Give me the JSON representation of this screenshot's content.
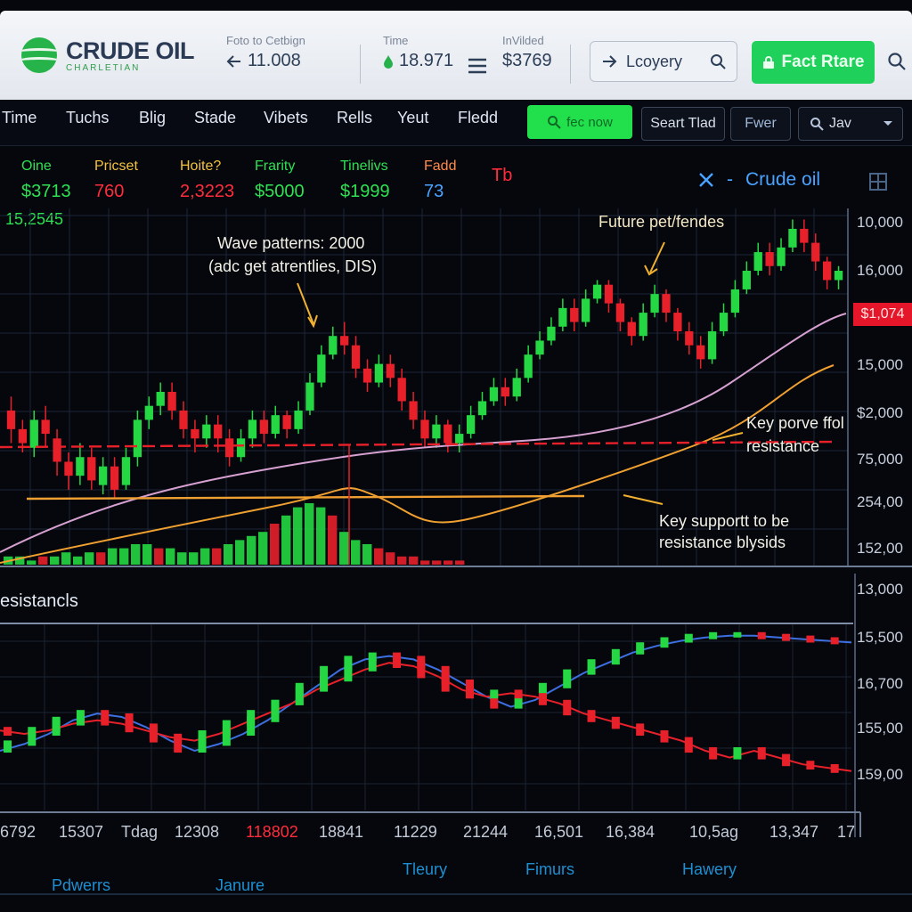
{
  "header": {
    "logo_title": "CRUDE OIL",
    "logo_sub": "CHARLETIAN",
    "stats": [
      {
        "label": "Foto to Cetbign",
        "value": "11.008",
        "icon": "arrow-left-icon"
      },
      {
        "label": "Time",
        "value": "18.971",
        "icon": "drop-icon"
      },
      {
        "label": "InVilded",
        "value": "$3769",
        "icon": "menu-icon"
      }
    ],
    "search_label": "Lcoyery",
    "green_button": "Fact Rtare"
  },
  "nav": {
    "items": [
      "Time",
      "Tuchs",
      "Blig",
      "Stade",
      "Vibets",
      "Rells",
      "Yeut",
      "Fledd"
    ],
    "green_button": "fec now",
    "button_2": "Seart Tlad",
    "button_3": "Fwer",
    "button_4": "Jav"
  },
  "ticker": [
    {
      "label": "Oine",
      "value": "$3713",
      "label_color": "#2ee052",
      "value_color": "#2ee052"
    },
    {
      "label": "Pricset",
      "value": "760",
      "label_color": "#f2c240",
      "value_color": "#ff2d3c"
    },
    {
      "label": "Hoite?",
      "value": "2,3223",
      "label_color": "#f2c240",
      "value_color": "#ff2d3c"
    },
    {
      "label": "Frarity",
      "value": "$5000",
      "label_color": "#2ee052",
      "value_color": "#2ee052"
    },
    {
      "label": "Tinelivs",
      "value": "$1999",
      "label_color": "#2ee052",
      "value_color": "#2ee052"
    },
    {
      "label": "Fadd",
      "value": "73",
      "label_color": "#ff8a4a",
      "value_color": "#4aa3ff"
    },
    {
      "label": "",
      "value": "Tb",
      "label_color": "#ff2d3c",
      "value_color": "#ff2d3c"
    }
  ],
  "ticker_extra": "15,2545",
  "chart_title": "Crude oil",
  "annotations": {
    "wave": "Wave patterns: 2000",
    "wave_sub": "(adc get atrentlies, DIS)",
    "future": "Future pet/fendes",
    "key_resistance_1": "Key porve ffol",
    "key_resistance_2": "resistance",
    "key_support_1": "Key supportt to be",
    "key_support_2": "resistance blysids"
  },
  "price_tag": "$1,074",
  "y_axis_upper": [
    "10,000",
    "16,000",
    "15,000",
    "$2,000",
    "75,000",
    "254,00",
    "152,00"
  ],
  "y_axis_lower": [
    "13,000",
    "15,500",
    "16,700",
    "155,00",
    "159,00"
  ],
  "lower_title": "esistancls",
  "x_axis": [
    "6792",
    "15307",
    "Tdag",
    "12308",
    "118802",
    "18841",
    "11229",
    "21244",
    "16,501",
    "16,384",
    "10,5ag",
    "13,347",
    "17"
  ],
  "footer": [
    "Pdwerrs",
    "Janure",
    "Tleury",
    "Fimurs",
    "Hawery"
  ],
  "colors": {
    "up": "#25d843",
    "down": "#e8202a",
    "accent_blue": "#4aa3ff",
    "support": "#f0a030",
    "resistance": "#e8202a"
  },
  "chart_data": [
    {
      "type": "candlestick",
      "title": "Crude oil",
      "ylabel_ticks": [
        "10,000",
        "16,000",
        "15,000",
        "$2,000",
        "75,000",
        "254,00",
        "152,00"
      ],
      "series": [
        {
          "kind": "candles",
          "values": [
            [
              0.72,
              0.68,
              0.75,
              0.65
            ],
            [
              0.68,
              0.65,
              0.7,
              0.63
            ],
            [
              0.64,
              0.7,
              0.72,
              0.62
            ],
            [
              0.7,
              0.67,
              0.73,
              0.64
            ],
            [
              0.66,
              0.61,
              0.68,
              0.58
            ],
            [
              0.61,
              0.58,
              0.63,
              0.55
            ],
            [
              0.58,
              0.62,
              0.65,
              0.56
            ],
            [
              0.62,
              0.57,
              0.64,
              0.55
            ],
            [
              0.56,
              0.6,
              0.62,
              0.54
            ],
            [
              0.6,
              0.55,
              0.62,
              0.53
            ],
            [
              0.56,
              0.62,
              0.64,
              0.55
            ],
            [
              0.62,
              0.7,
              0.72,
              0.6
            ],
            [
              0.7,
              0.73,
              0.75,
              0.68
            ],
            [
              0.73,
              0.76,
              0.78,
              0.71
            ],
            [
              0.76,
              0.72,
              0.78,
              0.7
            ],
            [
              0.72,
              0.68,
              0.74,
              0.66
            ],
            [
              0.68,
              0.66,
              0.7,
              0.63
            ],
            [
              0.66,
              0.69,
              0.71,
              0.64
            ],
            [
              0.69,
              0.66,
              0.71,
              0.63
            ],
            [
              0.66,
              0.62,
              0.68,
              0.6
            ],
            [
              0.62,
              0.66,
              0.68,
              0.61
            ],
            [
              0.66,
              0.7,
              0.72,
              0.64
            ],
            [
              0.7,
              0.67,
              0.72,
              0.65
            ],
            [
              0.67,
              0.71,
              0.73,
              0.66
            ],
            [
              0.71,
              0.68,
              0.72,
              0.66
            ],
            [
              0.68,
              0.72,
              0.74,
              0.67
            ],
            [
              0.72,
              0.78,
              0.8,
              0.71
            ],
            [
              0.78,
              0.84,
              0.86,
              0.77
            ],
            [
              0.84,
              0.88,
              0.9,
              0.83
            ],
            [
              0.88,
              0.86,
              0.91,
              0.84
            ],
            [
              0.86,
              0.81,
              0.88,
              0.79
            ],
            [
              0.81,
              0.78,
              0.83,
              0.76
            ],
            [
              0.78,
              0.82,
              0.84,
              0.77
            ],
            [
              0.82,
              0.79,
              0.84,
              0.77
            ],
            [
              0.79,
              0.74,
              0.81,
              0.72
            ],
            [
              0.74,
              0.7,
              0.76,
              0.68
            ],
            [
              0.7,
              0.66,
              0.72,
              0.64
            ],
            [
              0.66,
              0.69,
              0.71,
              0.64
            ],
            [
              0.69,
              0.65,
              0.7,
              0.63
            ],
            [
              0.65,
              0.67,
              0.69,
              0.63
            ],
            [
              0.67,
              0.71,
              0.73,
              0.66
            ],
            [
              0.71,
              0.74,
              0.76,
              0.7
            ],
            [
              0.74,
              0.77,
              0.79,
              0.73
            ],
            [
              0.77,
              0.75,
              0.79,
              0.73
            ],
            [
              0.75,
              0.79,
              0.81,
              0.74
            ],
            [
              0.79,
              0.84,
              0.86,
              0.78
            ],
            [
              0.84,
              0.87,
              0.89,
              0.83
            ],
            [
              0.87,
              0.9,
              0.92,
              0.86
            ],
            [
              0.9,
              0.94,
              0.96,
              0.89
            ],
            [
              0.94,
              0.91,
              0.96,
              0.89
            ],
            [
              0.91,
              0.96,
              0.98,
              0.9
            ],
            [
              0.96,
              0.99,
              1.0,
              0.95
            ],
            [
              0.99,
              0.95,
              1.0,
              0.93
            ],
            [
              0.95,
              0.91,
              0.96,
              0.89
            ],
            [
              0.91,
              0.88,
              0.92,
              0.86
            ],
            [
              0.88,
              0.93,
              0.95,
              0.87
            ],
            [
              0.93,
              0.97,
              0.99,
              0.92
            ],
            [
              0.97,
              0.93,
              0.98,
              0.91
            ],
            [
              0.93,
              0.89,
              0.94,
              0.87
            ],
            [
              0.89,
              0.86,
              0.91,
              0.84
            ],
            [
              0.86,
              0.83,
              0.88,
              0.81
            ],
            [
              0.83,
              0.89,
              0.91,
              0.82
            ],
            [
              0.89,
              0.93,
              0.95,
              0.88
            ],
            [
              0.93,
              0.98,
              1.0,
              0.92
            ],
            [
              0.98,
              1.02,
              1.04,
              0.97
            ],
            [
              1.02,
              1.06,
              1.08,
              1.01
            ],
            [
              1.06,
              1.03,
              1.08,
              1.01
            ],
            [
              1.03,
              1.07,
              1.09,
              1.02
            ],
            [
              1.07,
              1.11,
              1.13,
              1.06
            ],
            [
              1.11,
              1.08,
              1.13,
              1.06
            ],
            [
              1.08,
              1.04,
              1.1,
              1.02
            ],
            [
              1.04,
              1.0,
              1.05,
              0.98
            ],
            [
              1.0,
              1.02,
              1.03,
              0.98
            ]
          ]
        },
        {
          "kind": "volume",
          "values": [
            2,
            2,
            1,
            2,
            2,
            3,
            2,
            3,
            3,
            4,
            4,
            5,
            5,
            4,
            4,
            3,
            3,
            4,
            4,
            5,
            6,
            7,
            8,
            10,
            12,
            14,
            15,
            14,
            12,
            8,
            6,
            5,
            4,
            3,
            2,
            2,
            1,
            1,
            1,
            1
          ]
        }
      ]
    },
    {
      "type": "line",
      "title": "esistancls",
      "ylabel_ticks": [
        "13,000",
        "15,500",
        "16,700",
        "155,00",
        "159,00"
      ],
      "series": [
        {
          "name": "",
          "values": [
            0.3,
            0.34,
            0.4,
            0.48,
            0.52,
            0.5,
            0.44,
            0.36,
            0.3,
            0.34,
            0.4,
            0.48,
            0.58,
            0.68,
            0.78,
            0.84,
            0.86,
            0.84,
            0.78,
            0.7,
            0.62,
            0.56,
            0.6,
            0.68,
            0.76,
            0.82,
            0.88,
            0.92,
            0.95,
            0.97,
            0.98,
            0.98,
            0.97,
            0.96,
            0.95,
            0.94
          ]
        },
        {
          "name": "",
          "values": [
            0.42,
            0.4,
            0.42,
            0.46,
            0.48,
            0.46,
            0.42,
            0.38,
            0.36,
            0.4,
            0.46,
            0.52,
            0.58,
            0.66,
            0.72,
            0.78,
            0.82,
            0.8,
            0.74,
            0.66,
            0.62,
            0.64,
            0.62,
            0.58,
            0.52,
            0.48,
            0.44,
            0.4,
            0.36,
            0.3,
            0.26,
            0.3,
            0.26,
            0.22,
            0.2,
            0.18
          ]
        }
      ]
    }
  ]
}
